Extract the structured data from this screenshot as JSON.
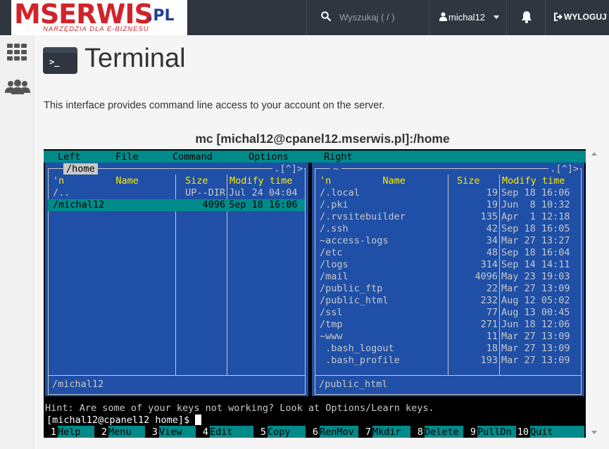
{
  "header": {
    "logo_main": "MSERWIS",
    "logo_tld": ".PL",
    "logo_tagline": "NARZĘDZIA DLA E-BIZNESU",
    "search_placeholder": "Wyszukaj ( / )",
    "username": "michal12",
    "logout_label": "WYLOGUJ"
  },
  "page": {
    "title": "Terminal",
    "description": "This interface provides command line access to your account on the server.",
    "terminal_title": "mc [michal12@cpanel12.mserwis.pl]:/home"
  },
  "terminal": {
    "menu": [
      "Left",
      "File",
      "Command",
      "Options",
      "Right"
    ],
    "left_panel": {
      "path": "/home",
      "corner": ".[^]>",
      "headers": {
        "name": "'n         Name",
        "size": "Size",
        "time": "Modify time"
      },
      "rows": [
        {
          "name": "/..",
          "size": "UP--DIR",
          "time": "Jul 24 04:04"
        },
        {
          "name": "/michal12",
          "size": "4096",
          "time": "Sep 18 16:06",
          "selected": true
        }
      ],
      "footer": "/michal12"
    },
    "right_panel": {
      "path": "~",
      "corner": ".[^]>",
      "headers": {
        "name": "'n         Name",
        "size": "Size",
        "time": "Modify time"
      },
      "rows": [
        {
          "name": "/.local",
          "size": "19",
          "time": "Sep 18 16:06"
        },
        {
          "name": "/.pki",
          "size": "19",
          "time": "Jun  8 10:32"
        },
        {
          "name": "/.rvsitebuilder",
          "size": "135",
          "time": "Apr  1 12:18"
        },
        {
          "name": "/.ssh",
          "size": "42",
          "time": "Sep 18 16:05"
        },
        {
          "name": "~access-logs",
          "size": "34",
          "time": "Mar 27 13:27"
        },
        {
          "name": "/etc",
          "size": "48",
          "time": "Sep 18 16:04"
        },
        {
          "name": "/logs",
          "size": "314",
          "time": "Sep 14 14:11"
        },
        {
          "name": "/mail",
          "size": "4096",
          "time": "May 23 19:03"
        },
        {
          "name": "/public_ftp",
          "size": "22",
          "time": "Mar 27 13:09"
        },
        {
          "name": "/public_html",
          "size": "232",
          "time": "Aug 12 05:02"
        },
        {
          "name": "/ssl",
          "size": "77",
          "time": "Aug 13 00:45"
        },
        {
          "name": "/tmp",
          "size": "271",
          "time": "Jun 18 12:06"
        },
        {
          "name": "~www",
          "size": "11",
          "time": "Mar 27 13:09"
        },
        {
          "name": " .bash_logout",
          "size": "18",
          "time": "Mar 27 13:09"
        },
        {
          "name": " .bash_profile",
          "size": "193",
          "time": "Mar 27 13:09"
        }
      ],
      "footer": "/public_html"
    },
    "hint": "Hint: Are some of your keys not working? Look at Options/Learn keys.",
    "prompt": "[michal12@cpanel12 home]$",
    "fkeys": [
      {
        "num": "1",
        "label": "Help"
      },
      {
        "num": "2",
        "label": "Menu"
      },
      {
        "num": "3",
        "label": "View"
      },
      {
        "num": "4",
        "label": "Edit"
      },
      {
        "num": "5",
        "label": "Copy"
      },
      {
        "num": "6",
        "label": "RenMov"
      },
      {
        "num": "7",
        "label": "Mkdir"
      },
      {
        "num": "8",
        "label": "Delete"
      },
      {
        "num": "9",
        "label": "PullDn"
      },
      {
        "num": "10",
        "label": "Quit"
      }
    ]
  },
  "colors": {
    "topbar": "#2f3640",
    "logo_red": "#d2232a",
    "logo_blue": "#1c3f94",
    "mc_panel_blue": "#1f4fa6",
    "mc_cyan": "#008b8b",
    "mc_header_yellow": "#ffe900"
  }
}
